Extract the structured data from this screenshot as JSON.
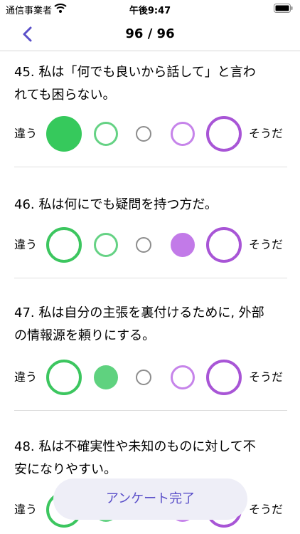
{
  "status_bar": {
    "carrier": "通信事業者",
    "time": "午後9:47"
  },
  "nav": {
    "title": "96 / 96"
  },
  "scale": {
    "left_label": "違う",
    "right_label": "そうだ"
  },
  "questions": [
    {
      "line1": "45. 私は「何でも良いから話して」と言わ",
      "line2": "れても困らない。",
      "selected": 1
    },
    {
      "line1": "46. 私は何にでも疑問を持つ方だ。",
      "line2": "",
      "selected": 4
    },
    {
      "line1": "47. 私は自分の主張を裏付けるために, 外部",
      "line2": "の情報源を頼りにする。",
      "selected": 2
    },
    {
      "line1": "48. 私は不確実性や未知のものに対して不",
      "line2": "安になりやすい。",
      "selected": 0
    }
  ],
  "footer": {
    "complete_label": "アンケート完了"
  },
  "colors": {
    "accent": "#5a4fc9",
    "agree_green": "#36c95c",
    "disagree_purple": "#a855d6"
  }
}
